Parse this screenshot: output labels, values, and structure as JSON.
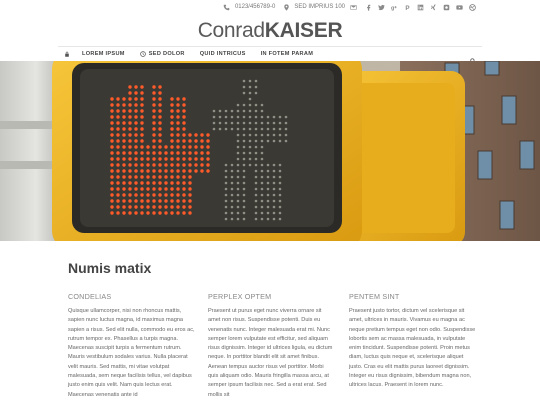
{
  "topbar": {
    "phone": "0123/456789-0",
    "address": "SED IMPRIUS 100",
    "icons": [
      "phone-icon",
      "map-pin-icon",
      "envelope-icon",
      "facebook-icon",
      "twitter-icon",
      "google-plus-icon",
      "pinterest-icon",
      "linkedin-icon",
      "xing-icon",
      "instagram-icon",
      "youtube-icon",
      "dribbble-icon"
    ]
  },
  "logo": {
    "light": "Conrad",
    "bold": "KAISER"
  },
  "nav": {
    "items": [
      "LOREM IPSUM",
      "SED DOLOR",
      "QUID INTRICUS",
      "IN FOTEM PARAM"
    ]
  },
  "main": {
    "title": "Numis matix",
    "columns": [
      {
        "heading": "CONDELIAS",
        "text": "Quisque ullamcorper, nisi non rhoncus mattis, sapien nunc luctus magna, id maximus magna sapien a risus. Sed elit nulla, commodo eu eros ac, rutrum tempor ex. Phasellus a turpis magna. Maecenas suscipit turpis a fermentum rutrum. Mauris vestibulum sodales varius. Nulla placerat velit mauris. Sed mattis, mi vitae volutpat malesuada, sem neque facilisis tellus, vel dapibus justo enim quis velit. Nam quis lectus erat. Maecenas venenatis ante id"
      },
      {
        "heading": "PERPLEX OPTEM",
        "text": "Praesent ut purus eget nunc viverra ornare sit amet non risus. Suspendisse potenti. Duis eu venenatis nunc. Integer malesuada erat mi. Nunc semper lorem vulputate est efficitur, sed aliquam risus dignissim. Integer id ultrices ligula, eu dictum neque. In porttitor blandit elit sit amet finibus. Aenean tempus auctor risus vel porttitor. Morbi quis aliquam odio. Mauris fringilla massa arcu, at semper ipsum facilisis nec. Sed a erat erat. Sed mollis sit"
      },
      {
        "heading": "PENTEM SINT",
        "text": "Praesent justo tortor, dictum vel scelerisque sit amet, ultrices in mauris. Vivamus eu magna ac neque pretium tempus eget non odio. Suspendisse lobortis sem ac massa malesuada, in vulputate enim tincidunt. Suspendisse potenti. Proin metus diam, luctus quis neque et, scelerisque aliquet justo. Cras eu elit mattis purus laoreet dignissim. Integer eu risus dignissim, bibendum magna non, ultrices lacus. Praesent in lorem nunc."
      }
    ]
  },
  "colors": {
    "signal_yellow": "#f2b21b",
    "hand_red": "#ff5a2a",
    "text_dark": "#444444"
  }
}
